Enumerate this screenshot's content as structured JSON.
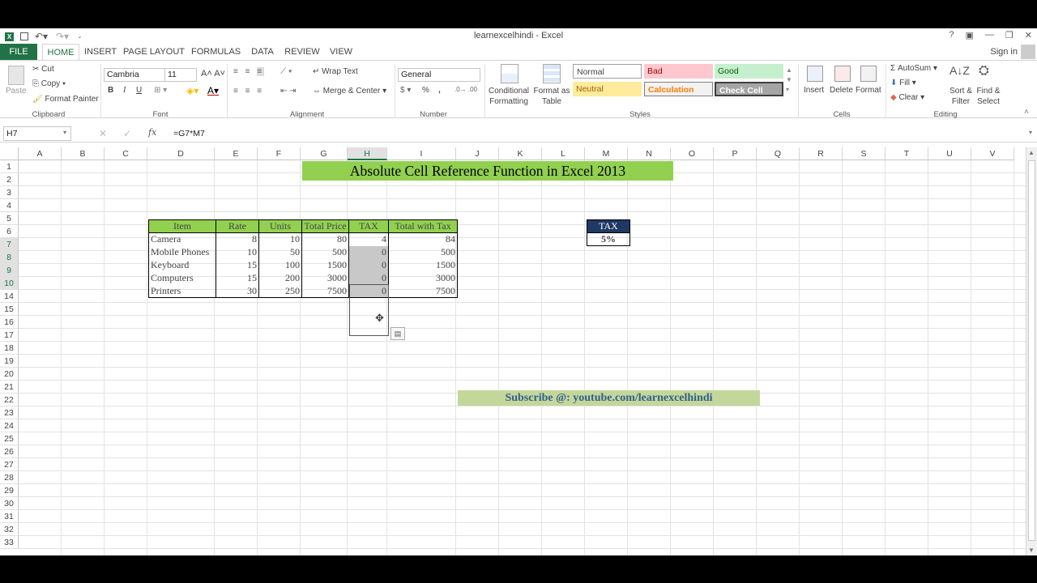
{
  "app": {
    "title": "learnexcelhindi - Excel",
    "sign_in": "Sign in"
  },
  "tabs": [
    {
      "label": "FILE"
    },
    {
      "label": "HOME"
    },
    {
      "label": "INSERT"
    },
    {
      "label": "PAGE LAYOUT"
    },
    {
      "label": "FORMULAS"
    },
    {
      "label": "DATA"
    },
    {
      "label": "REVIEW"
    },
    {
      "label": "VIEW"
    }
  ],
  "ribbon": {
    "clipboard": {
      "group": "Clipboard",
      "paste": "Paste",
      "cut": "Cut",
      "copy": "Copy",
      "format_painter": "Format Painter"
    },
    "font": {
      "group": "Font",
      "name": "Cambria",
      "size": "11",
      "bold": "B",
      "italic": "I",
      "underline": "U"
    },
    "alignment": {
      "group": "Alignment",
      "wrap_text": "Wrap Text",
      "merge_center": "Merge & Center"
    },
    "number": {
      "group": "Number",
      "format": "General",
      "percent": "%",
      "comma": ","
    },
    "styles": {
      "group": "Styles",
      "conditional_formatting": "Conditional Formatting",
      "format_as_table": "Format as Table",
      "items": [
        {
          "label": "Normal",
          "bg": "#ffffff",
          "color": "#000000"
        },
        {
          "label": "Bad",
          "bg": "#ffc7ce",
          "color": "#9c0006"
        },
        {
          "label": "Good",
          "bg": "#c6efce",
          "color": "#006100"
        },
        {
          "label": "Neutral",
          "bg": "#ffeb9c",
          "color": "#9c6500"
        },
        {
          "label": "Calculation",
          "bg": "#f2f2f2",
          "color": "#fa7d00"
        },
        {
          "label": "Check Cell",
          "bg": "#a5a5a5",
          "color": "#ffffff"
        }
      ]
    },
    "cells": {
      "group": "Cells",
      "insert": "Insert",
      "delete": "Delete",
      "format": "Format"
    },
    "editing": {
      "group": "Editing",
      "autosum": "AutoSum",
      "fill": "Fill",
      "clear": "Clear",
      "sort_filter": "Sort & Filter",
      "find_select": "Find & Select"
    }
  },
  "formula_bar": {
    "name_box": "H7",
    "fx": "fx",
    "formula": "=G7*M7"
  },
  "columns": [
    "A",
    "B",
    "C",
    "D",
    "E",
    "F",
    "G",
    "H",
    "I",
    "J",
    "K",
    "L",
    "M",
    "N",
    "O",
    "P",
    "Q",
    "R",
    "S",
    "T",
    "U",
    "V"
  ],
  "rows": [
    "1",
    "2",
    "3",
    "4",
    "5",
    "6",
    "7",
    "8",
    "9",
    "10",
    "14",
    "15",
    "16",
    "17",
    "18",
    "19",
    "20",
    "21",
    "22",
    "23",
    "24",
    "25",
    "26",
    "27",
    "28",
    "29",
    "30",
    "31",
    "32",
    "33"
  ],
  "sheet": {
    "title": "Absolute Cell Reference Function in Excel 2013",
    "table": {
      "headers": [
        "Item",
        "Rate",
        "Units",
        "Total Price",
        "TAX",
        "Total with Tax"
      ],
      "rows": [
        [
          "Camera",
          "8",
          "10",
          "80",
          "4",
          "84"
        ],
        [
          "Mobile Phones",
          "10",
          "50",
          "500",
          "0",
          "500"
        ],
        [
          "Keyboard",
          "15",
          "100",
          "1500",
          "0",
          "1500"
        ],
        [
          "Computers",
          "15",
          "200",
          "3000",
          "0",
          "3000"
        ],
        [
          "Printers",
          "30",
          "250",
          "7500",
          "0",
          "7500"
        ]
      ]
    },
    "tax_box": {
      "label": "TAX",
      "value": "5%"
    },
    "subscribe": "Subscribe @: youtube.com/learnexcelhindi",
    "colors": {
      "header_fill": "#92d050",
      "banner_fill": "#92d050",
      "subscribe_fill": "#c4d79b",
      "tax_header_fill": "#1f3864",
      "selection_fill": "#c8c8c8",
      "excel_green": "#217346"
    }
  }
}
